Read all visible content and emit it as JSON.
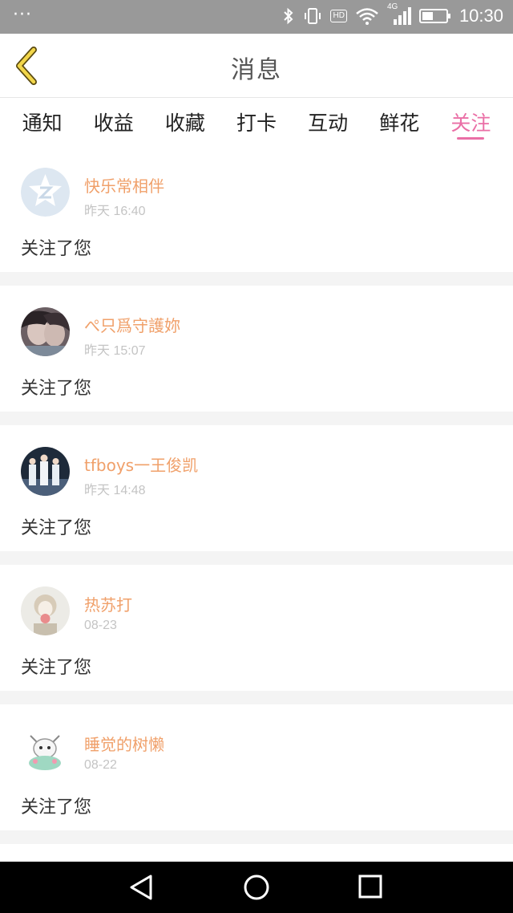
{
  "status_bar": {
    "left": "···",
    "network": "4G",
    "hd": "HD",
    "time": "10:30"
  },
  "header": {
    "title": "消息"
  },
  "tabs": [
    {
      "label": "通知",
      "active": false
    },
    {
      "label": "收益",
      "active": false
    },
    {
      "label": "收藏",
      "active": false
    },
    {
      "label": "打卡",
      "active": false
    },
    {
      "label": "互动",
      "active": false
    },
    {
      "label": "鲜花",
      "active": false
    },
    {
      "label": "关注",
      "active": true
    }
  ],
  "items": [
    {
      "name": "快乐常相伴",
      "time": "昨天 16:40",
      "message": "关注了您"
    },
    {
      "name": "ぺ只爲守護妳",
      "time": "昨天 15:07",
      "message": "关注了您"
    },
    {
      "name": "tfboys一王俊凯",
      "time": "昨天 14:48",
      "message": "关注了您"
    },
    {
      "name": "热苏打",
      "time": "08-23",
      "message": "关注了您"
    },
    {
      "name": "睡觉的树懒",
      "time": "08-22",
      "message": "关注了您"
    }
  ],
  "colors": {
    "accent": "#ea6fa6",
    "username": "#f0a06a",
    "status_bar": "#999999",
    "back_icon": "#f0d040"
  },
  "icons": [
    "back-arrow-icon",
    "bluetooth-icon",
    "vibrate-icon",
    "wifi-icon",
    "signal-icon",
    "battery-icon",
    "nav-back-icon",
    "nav-home-icon",
    "nav-recents-icon"
  ]
}
